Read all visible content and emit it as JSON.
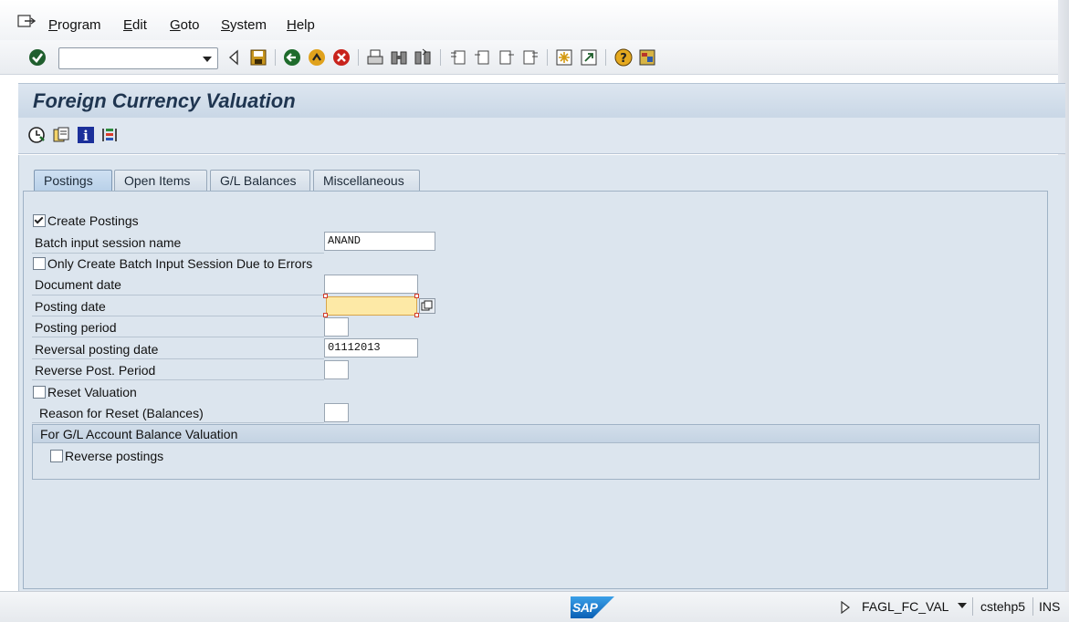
{
  "menu": {
    "items": [
      "Program",
      "Edit",
      "Goto",
      "System",
      "Help"
    ]
  },
  "toolbar": {
    "command_field_value": "",
    "icons": [
      "enter-icon",
      "back-icon",
      "save-icon",
      "back-green-icon",
      "exit-icon",
      "cancel-icon",
      "print-icon",
      "find-icon",
      "find-next-icon",
      "first-page-icon",
      "previous-page-icon",
      "next-page-icon",
      "last-page-icon",
      "create-session-icon",
      "shortcut-icon",
      "help-icon",
      "customize-layout-icon"
    ]
  },
  "page": {
    "title": "Foreign Currency Valuation",
    "app_toolbar_icons": [
      "execute-icon",
      "get-variant-icon",
      "info-icon",
      "selection-options-icon"
    ]
  },
  "tabs": [
    {
      "label": "Postings",
      "active": true
    },
    {
      "label": "Open Items",
      "active": false
    },
    {
      "label": "G/L Balances",
      "active": false
    },
    {
      "label": "Miscellaneous",
      "active": false
    }
  ],
  "form": {
    "create_postings": {
      "label": "Create Postings",
      "checked": true
    },
    "batch_session": {
      "label": "Batch input session name",
      "value": "ANAND"
    },
    "only_batch_errors": {
      "label": "Only Create Batch Input Session Due to Errors",
      "checked": false
    },
    "document_date": {
      "label": "Document date",
      "value": ""
    },
    "posting_date": {
      "label": "Posting date",
      "value": ""
    },
    "posting_period": {
      "label": "Posting period",
      "value": ""
    },
    "reversal_posting_date": {
      "label": "Reversal posting date",
      "value": "01112013"
    },
    "reverse_post_period": {
      "label": "Reverse Post. Period",
      "value": ""
    },
    "reset_valuation": {
      "label": "Reset Valuation",
      "checked": false
    },
    "reason_for_reset": {
      "label": "Reason for Reset (Balances)",
      "value": ""
    }
  },
  "group": {
    "title": "For G/L Account Balance Valuation",
    "reverse_postings": {
      "label": "Reverse postings",
      "checked": false
    }
  },
  "status_bar": {
    "logo_text": "SAP",
    "transaction": "FAGL_FC_VAL",
    "server": "cstehp5",
    "mode": "INS"
  },
  "colors": {
    "focus_field": "#fde9a6",
    "panel_bg": "#dce5ee",
    "title_color": "#1f3550",
    "sap_blue": "#1a7ac8"
  }
}
